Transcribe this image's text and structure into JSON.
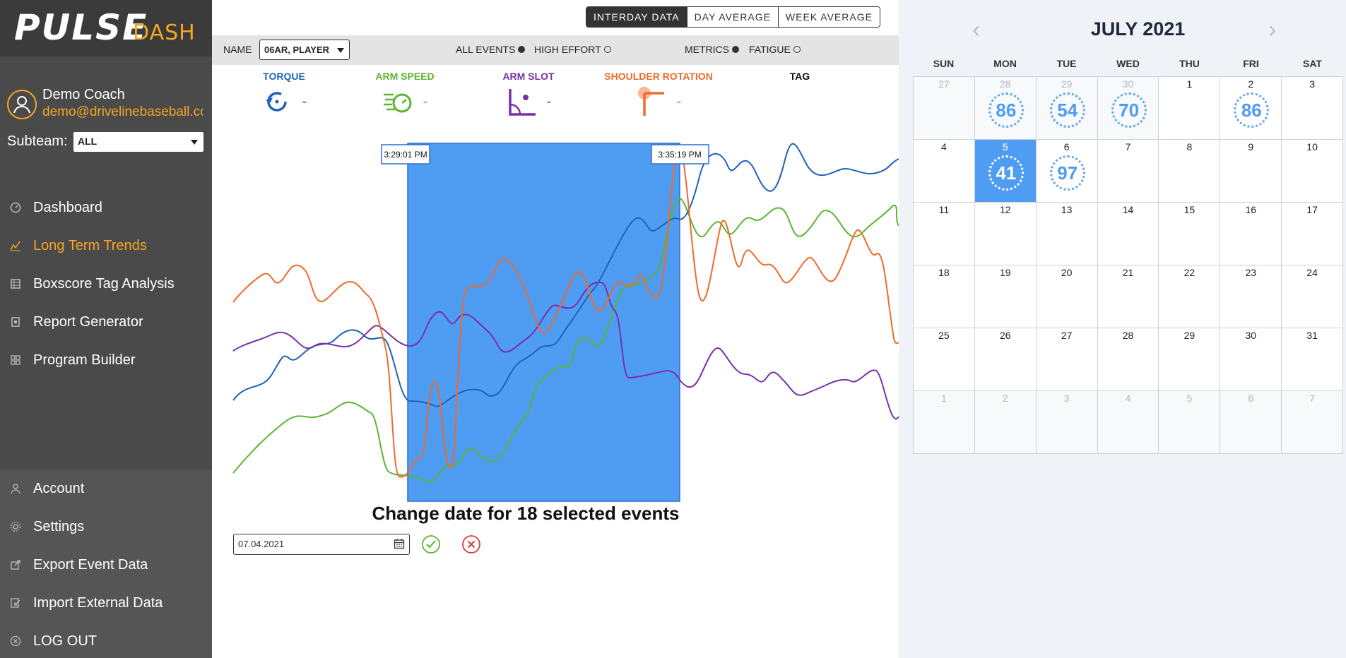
{
  "brand": {
    "word1": "PULSE",
    "word2": "DASH"
  },
  "user": {
    "name": "Demo Coach",
    "email": "demo@drivelinebaseball.com"
  },
  "subteam": {
    "label": "Subteam:",
    "value": "ALL"
  },
  "nav": {
    "items": [
      {
        "label": "Dashboard",
        "icon": "gauge-icon"
      },
      {
        "label": "Long Term Trends",
        "icon": "trend-icon",
        "active": true
      },
      {
        "label": "Boxscore Tag Analysis",
        "icon": "boxscore-icon"
      },
      {
        "label": "Report Generator",
        "icon": "report-icon"
      },
      {
        "label": "Program Builder",
        "icon": "grid-icon"
      }
    ],
    "lower": [
      {
        "label": "Account",
        "icon": "user-icon"
      },
      {
        "label": "Settings",
        "icon": "gear-icon"
      },
      {
        "label": "Export Event Data",
        "icon": "export-icon"
      },
      {
        "label": "Import External Data",
        "icon": "import-icon"
      },
      {
        "label": "LOG OUT",
        "icon": "logout-icon"
      }
    ]
  },
  "view_toggle": {
    "options": [
      "INTERDAY DATA",
      "DAY AVERAGE",
      "WEEK AVERAGE"
    ],
    "selected": "INTERDAY DATA"
  },
  "filters": {
    "name_label": "NAME",
    "name_value": "06AR, PLAYER",
    "all_events": "ALL EVENTS",
    "high_effort": "HIGH EFFORT",
    "metrics": "METRICS",
    "fatigue": "FATIGUE"
  },
  "metrics": [
    {
      "label": "TORQUE",
      "value": "-",
      "color": "#1f63b6"
    },
    {
      "label": "ARM SPEED",
      "value": "-",
      "color": "#5cb531"
    },
    {
      "label": "ARM SLOT",
      "value": "-",
      "color": "#7b2fa8"
    },
    {
      "label": "SHOULDER ROTATION",
      "value": "-",
      "color": "#f06a2a"
    },
    {
      "label": "TAG",
      "value": "",
      "color": "#111111"
    }
  ],
  "selection": {
    "start_time": "3:29:01 PM",
    "end_time": "3:35:19 PM",
    "fill": "#4f9cf3"
  },
  "change_date": {
    "title": "Change date for 18 selected events",
    "date_value": "07.04.2021"
  },
  "calendar": {
    "title": "JULY 2021",
    "days_of_week": [
      "SUN",
      "MON",
      "TUE",
      "WED",
      "THU",
      "FRI",
      "SAT"
    ],
    "weeks": [
      [
        {
          "d": "27",
          "o": true
        },
        {
          "d": "28",
          "o": true,
          "s": "86"
        },
        {
          "d": "29",
          "o": true,
          "s": "54"
        },
        {
          "d": "30",
          "o": true,
          "s": "70"
        },
        {
          "d": "1"
        },
        {
          "d": "2",
          "s": "86"
        },
        {
          "d": "3"
        }
      ],
      [
        {
          "d": "4"
        },
        {
          "d": "5",
          "s": "41",
          "sel": true
        },
        {
          "d": "6",
          "s": "97"
        },
        {
          "d": "7"
        },
        {
          "d": "8"
        },
        {
          "d": "9"
        },
        {
          "d": "10"
        }
      ],
      [
        {
          "d": "11"
        },
        {
          "d": "12"
        },
        {
          "d": "13"
        },
        {
          "d": "14"
        },
        {
          "d": "15"
        },
        {
          "d": "16"
        },
        {
          "d": "17"
        }
      ],
      [
        {
          "d": "18"
        },
        {
          "d": "19"
        },
        {
          "d": "20"
        },
        {
          "d": "21"
        },
        {
          "d": "22"
        },
        {
          "d": "23"
        },
        {
          "d": "24"
        }
      ],
      [
        {
          "d": "25"
        },
        {
          "d": "26"
        },
        {
          "d": "27"
        },
        {
          "d": "28"
        },
        {
          "d": "29"
        },
        {
          "d": "30"
        },
        {
          "d": "31"
        }
      ],
      [
        {
          "d": "1",
          "o": true
        },
        {
          "d": "2",
          "o": true
        },
        {
          "d": "3",
          "o": true
        },
        {
          "d": "4",
          "o": true
        },
        {
          "d": "5",
          "o": true
        },
        {
          "d": "6",
          "o": true
        },
        {
          "d": "7",
          "o": true
        }
      ]
    ]
  }
}
